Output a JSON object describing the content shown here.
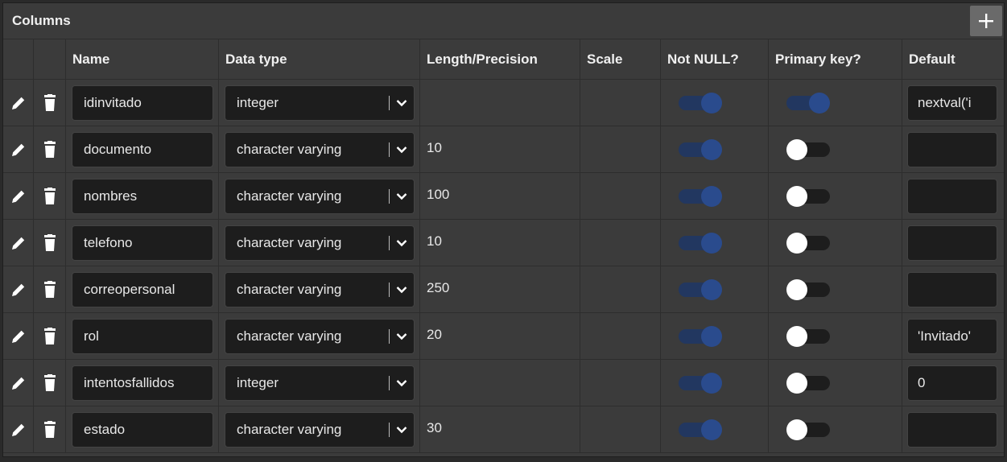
{
  "panel": {
    "title": "Columns",
    "add_label": "+"
  },
  "headers": {
    "name": "Name",
    "data_type": "Data type",
    "length": "Length/Precision",
    "scale": "Scale",
    "not_null": "Not NULL?",
    "primary_key": "Primary key?",
    "default": "Default"
  },
  "rows": [
    {
      "name": "idinvitado",
      "type": "integer",
      "length": "",
      "scale": "",
      "not_null": true,
      "primary_key": true,
      "default": "nextval('i"
    },
    {
      "name": "documento",
      "type": "character varying",
      "length": "10",
      "scale": "",
      "not_null": true,
      "primary_key": false,
      "default": ""
    },
    {
      "name": "nombres",
      "type": "character varying",
      "length": "100",
      "scale": "",
      "not_null": true,
      "primary_key": false,
      "default": ""
    },
    {
      "name": "telefono",
      "type": "character varying",
      "length": "10",
      "scale": "",
      "not_null": true,
      "primary_key": false,
      "default": ""
    },
    {
      "name": "correopersonal",
      "type": "character varying",
      "length": "250",
      "scale": "",
      "not_null": true,
      "primary_key": false,
      "default": ""
    },
    {
      "name": "rol",
      "type": "character varying",
      "length": "20",
      "scale": "",
      "not_null": true,
      "primary_key": false,
      "default": "'Invitado'"
    },
    {
      "name": "intentosfallidos",
      "type": "integer",
      "length": "",
      "scale": "",
      "not_null": true,
      "primary_key": false,
      "default": "0"
    },
    {
      "name": "estado",
      "type": "character varying",
      "length": "30",
      "scale": "",
      "not_null": true,
      "primary_key": false,
      "default": ""
    }
  ],
  "icons": {
    "edit": "pencil-icon",
    "delete": "trash-icon",
    "add": "plus-icon",
    "dropdown": "chevron-down-icon"
  },
  "colors": {
    "toggle_on": "#2a4b8d",
    "toggle_off_knob": "#ffffff",
    "panel_bg": "#3b3b3b",
    "input_bg": "#1d1d1d"
  }
}
